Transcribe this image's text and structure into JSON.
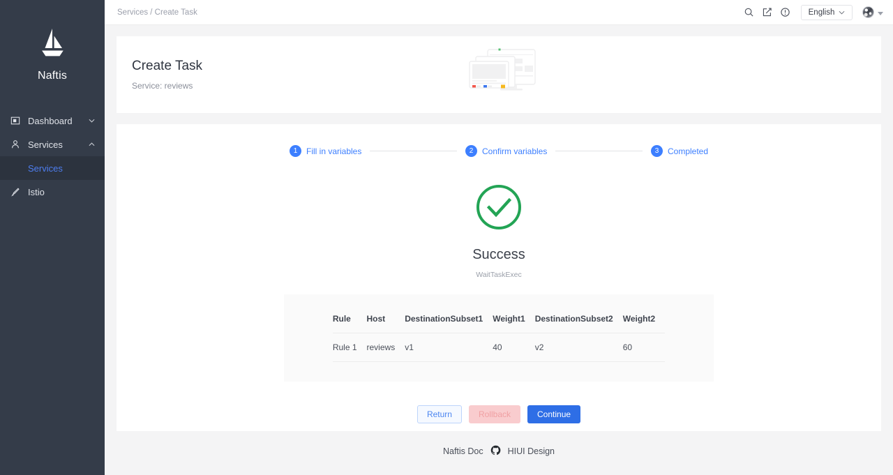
{
  "sidebar": {
    "brand": {
      "name": "Naftis",
      "logo_icon": "sailboat-icon"
    },
    "items": [
      {
        "label": "Dashboard",
        "icon": "dashboard-icon",
        "chevron": "chevron-down-icon"
      },
      {
        "label": "Services",
        "icon": "user-icon",
        "chevron": "chevron-up-icon"
      }
    ],
    "sub_item": {
      "label": "Services",
      "active": true
    },
    "istio": {
      "label": "Istio",
      "icon": "brush-icon"
    }
  },
  "topbar": {
    "breadcrumb": "Services / Create Task",
    "icons": [
      "search-icon",
      "edit-square-icon",
      "info-circle-icon"
    ],
    "language": {
      "value": "English",
      "chevron": "chevron-down-icon"
    },
    "avatar": "user-avatar",
    "avatar_caret": "caret-down-icon"
  },
  "header": {
    "title": "Create Task",
    "subtitle": "Service: reviews",
    "illustration": "monitor-windows-illustration"
  },
  "stepper": {
    "steps": [
      {
        "num": "1",
        "label": "Fill in variables"
      },
      {
        "num": "2",
        "label": "Confirm variables"
      },
      {
        "num": "3",
        "label": "Completed"
      }
    ],
    "active_color": "#3d7fff"
  },
  "result": {
    "status_icon": "check-circle-icon",
    "status_color": "#23a455",
    "title": "Success",
    "subtitle": "WaitTaskExec"
  },
  "table": {
    "columns": [
      "Rule",
      "Host",
      "DestinationSubset1",
      "Weight1",
      "DestinationSubset2",
      "Weight2"
    ],
    "rows": [
      {
        "rule": "Rule 1",
        "host": "reviews",
        "destination_subset_1": "v1",
        "weight_1": "40",
        "destination_subset_2": "v2",
        "weight_2": "60"
      }
    ]
  },
  "buttons": {
    "return": "Return",
    "rollback": "Rollback",
    "continue": "Continue"
  },
  "footer": {
    "doc_link": "Naftis Doc",
    "github_icon": "github-icon",
    "design_link": "HIUI Design"
  }
}
